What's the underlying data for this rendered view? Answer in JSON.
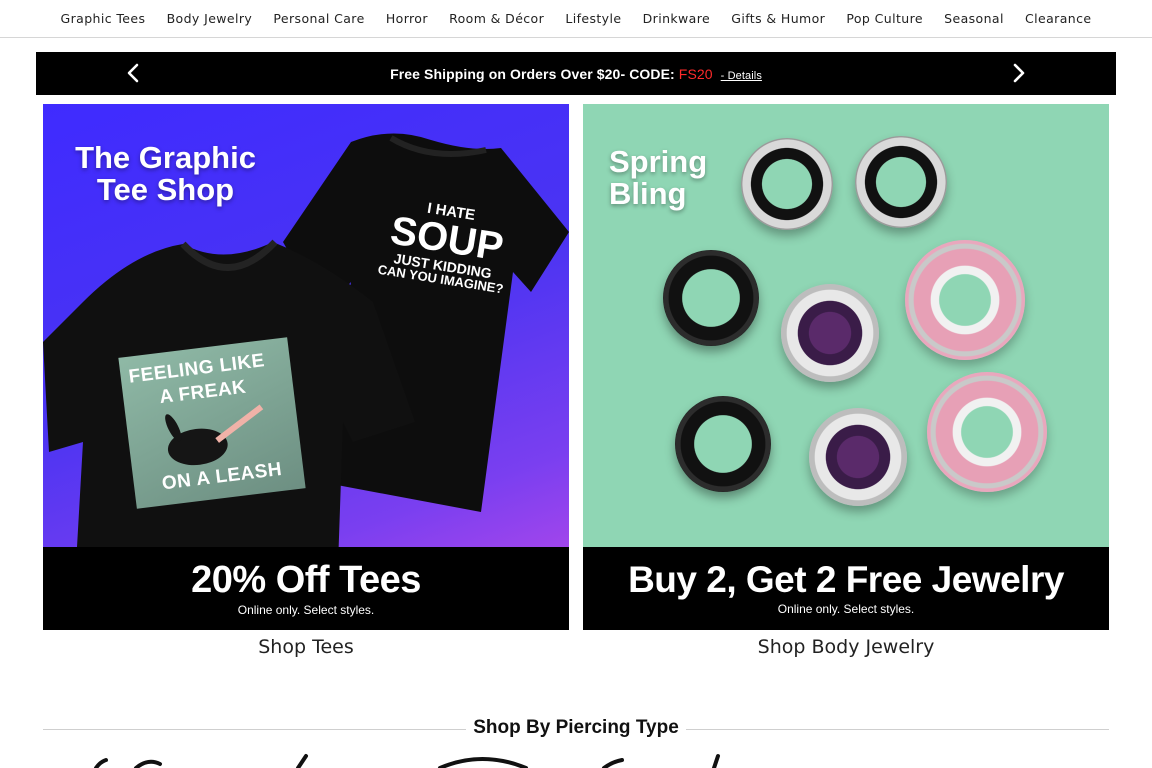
{
  "nav": {
    "items": [
      "Graphic Tees",
      "Body Jewelry",
      "Personal Care",
      "Horror",
      "Room & Décor",
      "Lifestyle",
      "Drinkware",
      "Gifts & Humor",
      "Pop Culture",
      "Seasonal",
      "Clearance"
    ]
  },
  "promo": {
    "text": "Free Shipping on Orders Over $20- CODE: ",
    "code": "FS20",
    "details": "- Details",
    "code_color": "#ff2a2a"
  },
  "banners": {
    "tees": {
      "headline_1": "The Graphic",
      "headline_2": "Tee Shop",
      "shirt_back_1": "I HATE",
      "shirt_back_2": "SOUP",
      "shirt_back_3": "JUST KIDDING",
      "shirt_back_4": "CAN YOU IMAGINE?",
      "patch_1": "FEELING LIKE",
      "patch_2": "A FREAK",
      "patch_3": "ON A LEASH",
      "offer": "20% Off Tees",
      "fine_print": "Online only. Select styles.",
      "link": "Shop Tees"
    },
    "jewelry": {
      "headline_1": "Spring",
      "headline_2": "Bling",
      "offer": "Buy 2, Get 2 Free Jewelry",
      "fine_print": "Online only. Select styles.",
      "link": "Shop Body Jewelry"
    }
  },
  "section": {
    "title": "Shop By Piercing Type"
  },
  "colors": {
    "promo_bg": "#000000",
    "tees_bg": "#4b34f2",
    "jewelry_bg": "#8fd6b4"
  }
}
